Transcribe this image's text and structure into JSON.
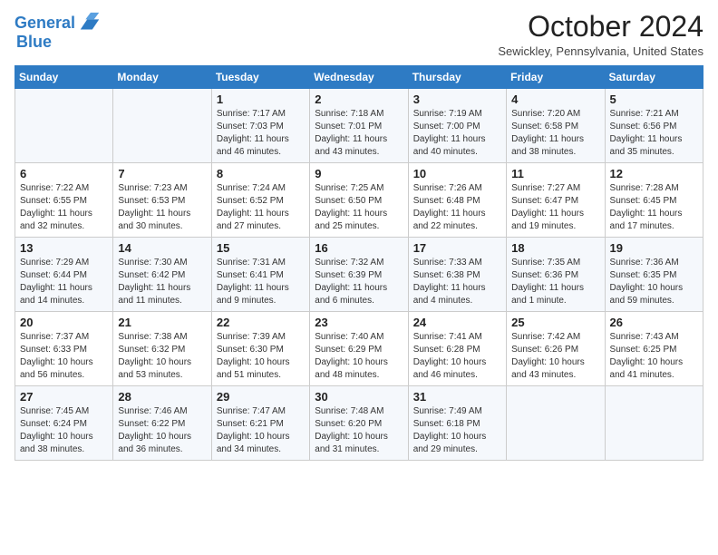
{
  "header": {
    "logo_line1": "General",
    "logo_line2": "Blue",
    "month_title": "October 2024",
    "subtitle": "Sewickley, Pennsylvania, United States"
  },
  "days_of_week": [
    "Sunday",
    "Monday",
    "Tuesday",
    "Wednesday",
    "Thursday",
    "Friday",
    "Saturday"
  ],
  "weeks": [
    [
      {
        "num": "",
        "info": ""
      },
      {
        "num": "",
        "info": ""
      },
      {
        "num": "1",
        "info": "Sunrise: 7:17 AM\nSunset: 7:03 PM\nDaylight: 11 hours and 46 minutes."
      },
      {
        "num": "2",
        "info": "Sunrise: 7:18 AM\nSunset: 7:01 PM\nDaylight: 11 hours and 43 minutes."
      },
      {
        "num": "3",
        "info": "Sunrise: 7:19 AM\nSunset: 7:00 PM\nDaylight: 11 hours and 40 minutes."
      },
      {
        "num": "4",
        "info": "Sunrise: 7:20 AM\nSunset: 6:58 PM\nDaylight: 11 hours and 38 minutes."
      },
      {
        "num": "5",
        "info": "Sunrise: 7:21 AM\nSunset: 6:56 PM\nDaylight: 11 hours and 35 minutes."
      }
    ],
    [
      {
        "num": "6",
        "info": "Sunrise: 7:22 AM\nSunset: 6:55 PM\nDaylight: 11 hours and 32 minutes."
      },
      {
        "num": "7",
        "info": "Sunrise: 7:23 AM\nSunset: 6:53 PM\nDaylight: 11 hours and 30 minutes."
      },
      {
        "num": "8",
        "info": "Sunrise: 7:24 AM\nSunset: 6:52 PM\nDaylight: 11 hours and 27 minutes."
      },
      {
        "num": "9",
        "info": "Sunrise: 7:25 AM\nSunset: 6:50 PM\nDaylight: 11 hours and 25 minutes."
      },
      {
        "num": "10",
        "info": "Sunrise: 7:26 AM\nSunset: 6:48 PM\nDaylight: 11 hours and 22 minutes."
      },
      {
        "num": "11",
        "info": "Sunrise: 7:27 AM\nSunset: 6:47 PM\nDaylight: 11 hours and 19 minutes."
      },
      {
        "num": "12",
        "info": "Sunrise: 7:28 AM\nSunset: 6:45 PM\nDaylight: 11 hours and 17 minutes."
      }
    ],
    [
      {
        "num": "13",
        "info": "Sunrise: 7:29 AM\nSunset: 6:44 PM\nDaylight: 11 hours and 14 minutes."
      },
      {
        "num": "14",
        "info": "Sunrise: 7:30 AM\nSunset: 6:42 PM\nDaylight: 11 hours and 11 minutes."
      },
      {
        "num": "15",
        "info": "Sunrise: 7:31 AM\nSunset: 6:41 PM\nDaylight: 11 hours and 9 minutes."
      },
      {
        "num": "16",
        "info": "Sunrise: 7:32 AM\nSunset: 6:39 PM\nDaylight: 11 hours and 6 minutes."
      },
      {
        "num": "17",
        "info": "Sunrise: 7:33 AM\nSunset: 6:38 PM\nDaylight: 11 hours and 4 minutes."
      },
      {
        "num": "18",
        "info": "Sunrise: 7:35 AM\nSunset: 6:36 PM\nDaylight: 11 hours and 1 minute."
      },
      {
        "num": "19",
        "info": "Sunrise: 7:36 AM\nSunset: 6:35 PM\nDaylight: 10 hours and 59 minutes."
      }
    ],
    [
      {
        "num": "20",
        "info": "Sunrise: 7:37 AM\nSunset: 6:33 PM\nDaylight: 10 hours and 56 minutes."
      },
      {
        "num": "21",
        "info": "Sunrise: 7:38 AM\nSunset: 6:32 PM\nDaylight: 10 hours and 53 minutes."
      },
      {
        "num": "22",
        "info": "Sunrise: 7:39 AM\nSunset: 6:30 PM\nDaylight: 10 hours and 51 minutes."
      },
      {
        "num": "23",
        "info": "Sunrise: 7:40 AM\nSunset: 6:29 PM\nDaylight: 10 hours and 48 minutes."
      },
      {
        "num": "24",
        "info": "Sunrise: 7:41 AM\nSunset: 6:28 PM\nDaylight: 10 hours and 46 minutes."
      },
      {
        "num": "25",
        "info": "Sunrise: 7:42 AM\nSunset: 6:26 PM\nDaylight: 10 hours and 43 minutes."
      },
      {
        "num": "26",
        "info": "Sunrise: 7:43 AM\nSunset: 6:25 PM\nDaylight: 10 hours and 41 minutes."
      }
    ],
    [
      {
        "num": "27",
        "info": "Sunrise: 7:45 AM\nSunset: 6:24 PM\nDaylight: 10 hours and 38 minutes."
      },
      {
        "num": "28",
        "info": "Sunrise: 7:46 AM\nSunset: 6:22 PM\nDaylight: 10 hours and 36 minutes."
      },
      {
        "num": "29",
        "info": "Sunrise: 7:47 AM\nSunset: 6:21 PM\nDaylight: 10 hours and 34 minutes."
      },
      {
        "num": "30",
        "info": "Sunrise: 7:48 AM\nSunset: 6:20 PM\nDaylight: 10 hours and 31 minutes."
      },
      {
        "num": "31",
        "info": "Sunrise: 7:49 AM\nSunset: 6:18 PM\nDaylight: 10 hours and 29 minutes."
      },
      {
        "num": "",
        "info": ""
      },
      {
        "num": "",
        "info": ""
      }
    ]
  ]
}
